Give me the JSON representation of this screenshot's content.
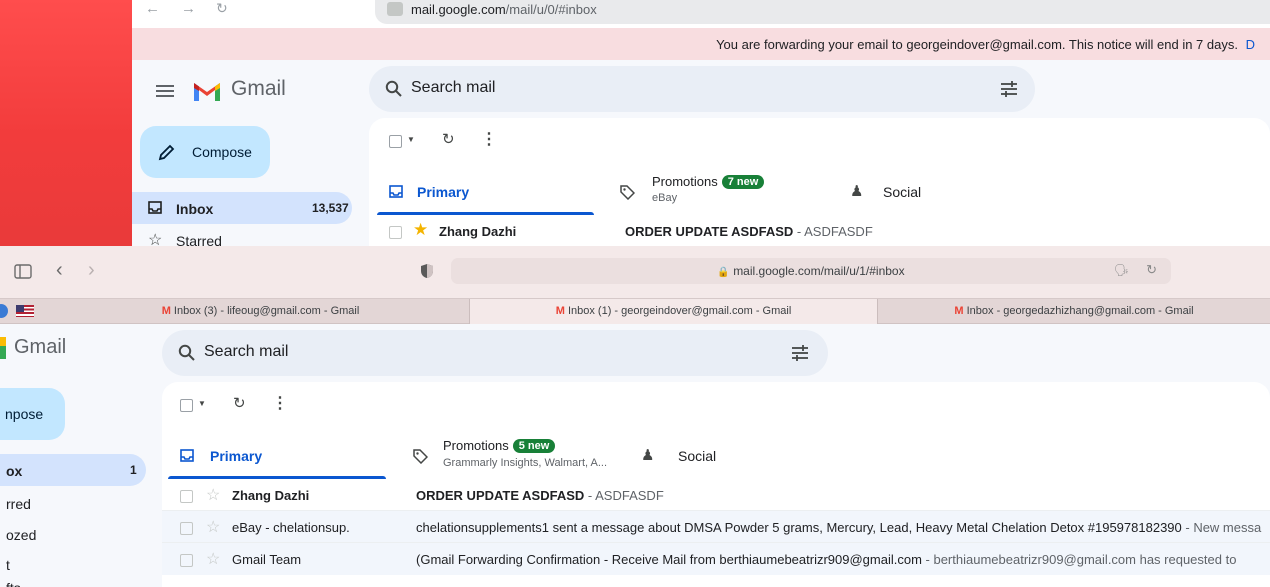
{
  "top_window": {
    "url_host": "mail.google.com",
    "url_path": "/mail/u/0/#inbox",
    "notice": "You are forwarding your email to georgeindover@gmail.com. This notice will end in 7 days.",
    "notice_link": "D",
    "app_name": "Gmail",
    "search_placeholder": "Search mail",
    "compose_label": "Compose",
    "nav": [
      {
        "label": "Inbox",
        "count": "13,537"
      },
      {
        "label": "Starred",
        "count": ""
      }
    ],
    "tabs": [
      {
        "label": "Primary",
        "badge": "",
        "sub": ""
      },
      {
        "label": "Promotions",
        "badge": "7 new",
        "sub": "eBay"
      },
      {
        "label": "Social",
        "badge": "",
        "sub": ""
      }
    ],
    "rows": [
      {
        "sender": "Zhang Dazhi",
        "subject": "ORDER UPDATE ASDFASD",
        "snippet": " - ASDFASDF",
        "starred": true
      }
    ]
  },
  "bottom_window": {
    "url": "mail.google.com/mail/u/1/#inbox",
    "browser_tabs": [
      {
        "label": "Inbox (3) - lifeoug@gmail.com - Gmail"
      },
      {
        "label": "Inbox (1) - georgeindover@gmail.com - Gmail"
      },
      {
        "label": "Inbox - georgedazhizhang@gmail.com - Gmail"
      }
    ],
    "app_name": "Gmail",
    "search_placeholder": "Search mail",
    "compose_label": "npose",
    "nav": [
      {
        "label": "ox",
        "count": "1"
      },
      {
        "label": "rred",
        "count": ""
      },
      {
        "label": "ozed",
        "count": ""
      },
      {
        "label": "t",
        "count": ""
      },
      {
        "label": "fts",
        "count": ""
      }
    ],
    "tabs": [
      {
        "label": "Primary",
        "badge": "",
        "sub": ""
      },
      {
        "label": "Promotions",
        "badge": "5 new",
        "sub": "Grammarly Insights, Walmart, A..."
      },
      {
        "label": "Social",
        "badge": "",
        "sub": ""
      }
    ],
    "rows": [
      {
        "sender": "Zhang Dazhi",
        "subject": "ORDER UPDATE ASDFASD",
        "snippet": " - ASDFASDF",
        "unread": true
      },
      {
        "sender": "eBay - chelationsup.",
        "subject": "chelationsupplements1 sent a message about DMSA Powder 5 grams, Mercury, Lead, Heavy Metal Chelation Detox #195978182390",
        "snippet": " - New messa",
        "unread": false
      },
      {
        "sender": "Gmail Team",
        "subject": "(Gmail Forwarding Confirmation - Receive Mail from berthiaumebeatrizr909@gmail.com",
        "snippet": " - berthiaumebeatrizr909@gmail.com has requested to",
        "unread": false
      }
    ]
  },
  "colors": {
    "accent_blue": "#0b57d0",
    "compose_bg": "#c2e7ff",
    "nav_active": "#d3e3fd",
    "badge_green": "#188038",
    "notice_bg": "#f8dde0",
    "star_gold": "#f4b400"
  }
}
